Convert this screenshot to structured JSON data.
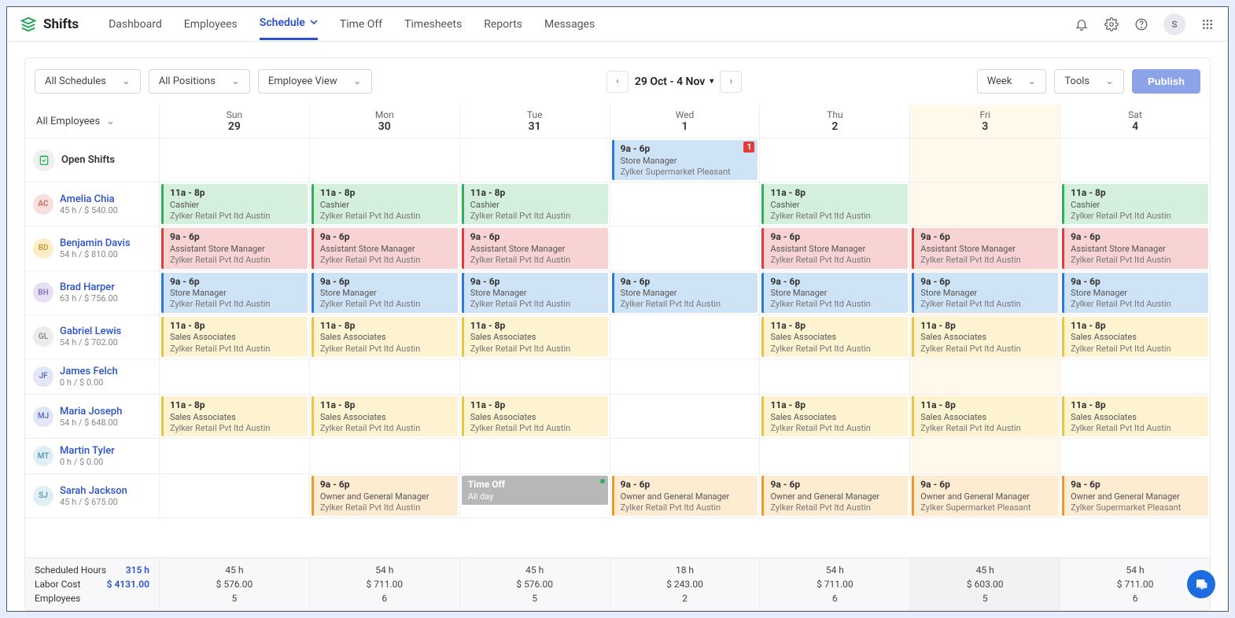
{
  "brand": "Shifts",
  "nav": {
    "dashboard": "Dashboard",
    "employees": "Employees",
    "schedule": "Schedule",
    "timeoff": "Time Off",
    "timesheets": "Timesheets",
    "reports": "Reports",
    "messages": "Messages"
  },
  "avatar_letter": "S",
  "toolbar": {
    "all_schedules": "All Schedules",
    "all_positions": "All Positions",
    "employee_view": "Employee View",
    "date_range": "29 Oct - 4 Nov",
    "week": "Week",
    "tools": "Tools",
    "publish": "Publish"
  },
  "header": {
    "all_employees": "All Employees",
    "days": [
      {
        "name": "Sun",
        "num": "29",
        "hi": false
      },
      {
        "name": "Mon",
        "num": "30",
        "hi": false
      },
      {
        "name": "Tue",
        "num": "31",
        "hi": false
      },
      {
        "name": "Wed",
        "num": "1",
        "hi": false
      },
      {
        "name": "Thu",
        "num": "2",
        "hi": false
      },
      {
        "name": "Fri",
        "num": "3",
        "hi": true
      },
      {
        "name": "Sat",
        "num": "4",
        "hi": false
      }
    ]
  },
  "open_shifts": {
    "label": "Open Shifts",
    "cells": [
      null,
      null,
      null,
      {
        "time": "9a - 6p",
        "role": "Store Manager",
        "loc": "Zylker Supermarket Pleasant",
        "cls": "blue",
        "badge": "1"
      },
      null,
      null,
      null
    ]
  },
  "employees": [
    {
      "init": "AC",
      "av_bg": "#f9dede",
      "av_fg": "#c76b6b",
      "name": "Amelia Chia",
      "meta": "45 h / $ 540.00",
      "cells": [
        {
          "time": "11a - 8p",
          "role": "Cashier",
          "loc": "Zylker Retail Pvt ltd Austin",
          "cls": "green"
        },
        {
          "time": "11a - 8p",
          "role": "Cashier",
          "loc": "Zylker Retail Pvt ltd Austin",
          "cls": "green"
        },
        {
          "time": "11a - 8p",
          "role": "Cashier",
          "loc": "Zylker Retail Pvt ltd Austin",
          "cls": "green"
        },
        null,
        {
          "time": "11a - 8p",
          "role": "Cashier",
          "loc": "Zylker Retail Pvt ltd Austin",
          "cls": "green"
        },
        null,
        {
          "time": "11a - 8p",
          "role": "Cashier",
          "loc": "Zylker Retail Pvt ltd Austin",
          "cls": "green"
        }
      ]
    },
    {
      "init": "BD",
      "av_bg": "#fceec9",
      "av_fg": "#c79a3a",
      "name": "Benjamin Davis",
      "meta": "54 h / $ 810.00",
      "cells": [
        {
          "time": "9a - 6p",
          "role": "Assistant Store Manager",
          "loc": "Zylker Retail Pvt ltd Austin",
          "cls": "red"
        },
        {
          "time": "9a - 6p",
          "role": "Assistant Store Manager",
          "loc": "Zylker Retail Pvt ltd Austin",
          "cls": "red"
        },
        {
          "time": "9a - 6p",
          "role": "Assistant Store Manager",
          "loc": "Zylker Retail Pvt ltd Austin",
          "cls": "red"
        },
        null,
        {
          "time": "9a - 6p",
          "role": "Assistant Store Manager",
          "loc": "Zylker Retail Pvt ltd Austin",
          "cls": "red"
        },
        {
          "time": "9a - 6p",
          "role": "Assistant Store Manager",
          "loc": "Zylker Retail Pvt ltd Austin",
          "cls": "red"
        },
        {
          "time": "9a - 6p",
          "role": "Assistant Store Manager",
          "loc": "Zylker Retail Pvt ltd Austin",
          "cls": "red"
        }
      ]
    },
    {
      "init": "BH",
      "av_bg": "#e7e0f4",
      "av_fg": "#8a6fc1",
      "name": "Brad Harper",
      "meta": "63 h / $ 756.00",
      "cells": [
        {
          "time": "9a - 6p",
          "role": "Store Manager",
          "loc": "Zylker Retail Pvt ltd Austin",
          "cls": "blue"
        },
        {
          "time": "9a - 6p",
          "role": "Store Manager",
          "loc": "Zylker Retail Pvt ltd Austin",
          "cls": "blue"
        },
        {
          "time": "9a - 6p",
          "role": "Store Manager",
          "loc": "Zylker Retail Pvt ltd Austin",
          "cls": "blue"
        },
        {
          "time": "9a - 6p",
          "role": "Store Manager",
          "loc": "Zylker Retail Pvt ltd Austin",
          "cls": "blue"
        },
        {
          "time": "9a - 6p",
          "role": "Store Manager",
          "loc": "Zylker Retail Pvt ltd Austin",
          "cls": "blue"
        },
        {
          "time": "9a - 6p",
          "role": "Store Manager",
          "loc": "Zylker Retail Pvt ltd Austin",
          "cls": "blue"
        },
        {
          "time": "9a - 6p",
          "role": "Store Manager",
          "loc": "Zylker Retail Pvt ltd Austin",
          "cls": "blue"
        }
      ]
    },
    {
      "init": "GL",
      "av_bg": "#ececec",
      "av_fg": "#888",
      "name": "Gabriel Lewis",
      "meta": "54 h / $ 702.00",
      "cells": [
        {
          "time": "11a - 8p",
          "role": "Sales Associates",
          "loc": "Zylker Retail Pvt ltd Austin",
          "cls": "yellow"
        },
        {
          "time": "11a - 8p",
          "role": "Sales Associates",
          "loc": "Zylker Retail Pvt ltd Austin",
          "cls": "yellow"
        },
        {
          "time": "11a - 8p",
          "role": "Sales Associates",
          "loc": "Zylker Retail Pvt ltd Austin",
          "cls": "yellow"
        },
        null,
        {
          "time": "11a - 8p",
          "role": "Sales Associates",
          "loc": "Zylker Retail Pvt ltd Austin",
          "cls": "yellow"
        },
        {
          "time": "11a - 8p",
          "role": "Sales Associates",
          "loc": "Zylker Retail Pvt ltd Austin",
          "cls": "yellow"
        },
        {
          "time": "11a - 8p",
          "role": "Sales Associates",
          "loc": "Zylker Retail Pvt ltd Austin",
          "cls": "yellow"
        }
      ]
    },
    {
      "init": "JF",
      "av_bg": "#e2e6f6",
      "av_fg": "#5d6fc1",
      "name": "James Felch",
      "meta": "0 h / $ 0.00",
      "cells": [
        null,
        null,
        null,
        null,
        null,
        null,
        null
      ]
    },
    {
      "init": "MJ",
      "av_bg": "#e2e6f6",
      "av_fg": "#5d6fc1",
      "name": "Maria Joseph",
      "meta": "54 h / $ 648.00",
      "cells": [
        {
          "time": "11a - 8p",
          "role": "Sales Associates",
          "loc": "Zylker Retail Pvt ltd Austin",
          "cls": "yellow"
        },
        {
          "time": "11a - 8p",
          "role": "Sales Associates",
          "loc": "Zylker Retail Pvt ltd Austin",
          "cls": "yellow"
        },
        {
          "time": "11a - 8p",
          "role": "Sales Associates",
          "loc": "Zylker Retail Pvt ltd Austin",
          "cls": "yellow"
        },
        null,
        {
          "time": "11a - 8p",
          "role": "Sales Associates",
          "loc": "Zylker Retail Pvt ltd Austin",
          "cls": "yellow"
        },
        {
          "time": "11a - 8p",
          "role": "Sales Associates",
          "loc": "Zylker Retail Pvt ltd Austin",
          "cls": "yellow"
        },
        {
          "time": "11a - 8p",
          "role": "Sales Associates",
          "loc": "Zylker Retail Pvt ltd Austin",
          "cls": "yellow"
        }
      ]
    },
    {
      "init": "MT",
      "av_bg": "#dff0f4",
      "av_fg": "#5a9aaa",
      "name": "Martin Tyler",
      "meta": "0 h / $ 0.00",
      "cells": [
        null,
        null,
        null,
        null,
        null,
        null,
        null
      ]
    },
    {
      "init": "SJ",
      "av_bg": "#dff0f4",
      "av_fg": "#5a9aaa",
      "name": "Sarah Jackson",
      "meta": "45 h / $ 675.00",
      "cells": [
        null,
        {
          "time": "9a - 6p",
          "role": "Owner and General Manager",
          "loc": "Zylker Retail Pvt ltd Austin",
          "cls": "orange"
        },
        {
          "time": "Time Off",
          "role": "All day",
          "loc": "",
          "cls": "gray",
          "dot": true
        },
        {
          "time": "9a - 6p",
          "role": "Owner and General Manager",
          "loc": "Zylker Retail Pvt ltd Austin",
          "cls": "orange"
        },
        {
          "time": "9a - 6p",
          "role": "Owner and General Manager",
          "loc": "Zylker Retail Pvt ltd Austin",
          "cls": "orange"
        },
        {
          "time": "9a - 6p",
          "role": "Owner and General Manager",
          "loc": "Zylker Supermarket Pleasant",
          "cls": "orange"
        },
        {
          "time": "9a - 6p",
          "role": "Owner and General Manager",
          "loc": "Zylker Supermarket Pleasant",
          "cls": "orange"
        }
      ]
    }
  ],
  "footer": {
    "scheduled_label": "Scheduled Hours",
    "scheduled_total": "315 h",
    "labor_label": "Labor Cost",
    "labor_total": "$ 4131.00",
    "employees_label": "Employees",
    "cols": [
      {
        "h": "45 h",
        "c": "$ 576.00",
        "e": "5"
      },
      {
        "h": "54 h",
        "c": "$ 711.00",
        "e": "6"
      },
      {
        "h": "45 h",
        "c": "$ 576.00",
        "e": "5"
      },
      {
        "h": "18 h",
        "c": "$ 243.00",
        "e": "2"
      },
      {
        "h": "54 h",
        "c": "$ 711.00",
        "e": "6"
      },
      {
        "h": "45 h",
        "c": "$ 603.00",
        "e": "5",
        "hi": true
      },
      {
        "h": "54 h",
        "c": "$ 711.00",
        "e": "6"
      }
    ]
  }
}
